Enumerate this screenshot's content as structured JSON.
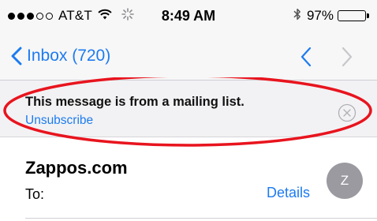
{
  "status_bar": {
    "signal_filled": 3,
    "signal_total": 5,
    "carrier": "AT&T",
    "wifi_icon": "wifi-icon",
    "activity_icon": "activity-spinner-icon",
    "time": "8:49 AM",
    "bluetooth_icon": "bluetooth-icon",
    "battery_text": "97%",
    "battery_level": 0.97
  },
  "nav": {
    "back_label": "Inbox (720)",
    "up_icon": "chevron-up-icon",
    "down_icon": "chevron-down-icon",
    "accent_color": "#1d7bf0",
    "disabled_color": "#c7c7cc"
  },
  "banner": {
    "message": "This message is from a mailing list.",
    "unsubscribe_label": "Unsubscribe",
    "close_icon": "close-circle-icon",
    "annotation_color": "#e8141e"
  },
  "email": {
    "sender": "Zappos.com",
    "to_label": "To:",
    "details_label": "Details",
    "avatar_initial": "Z",
    "avatar_color": "#9a9aa0"
  }
}
